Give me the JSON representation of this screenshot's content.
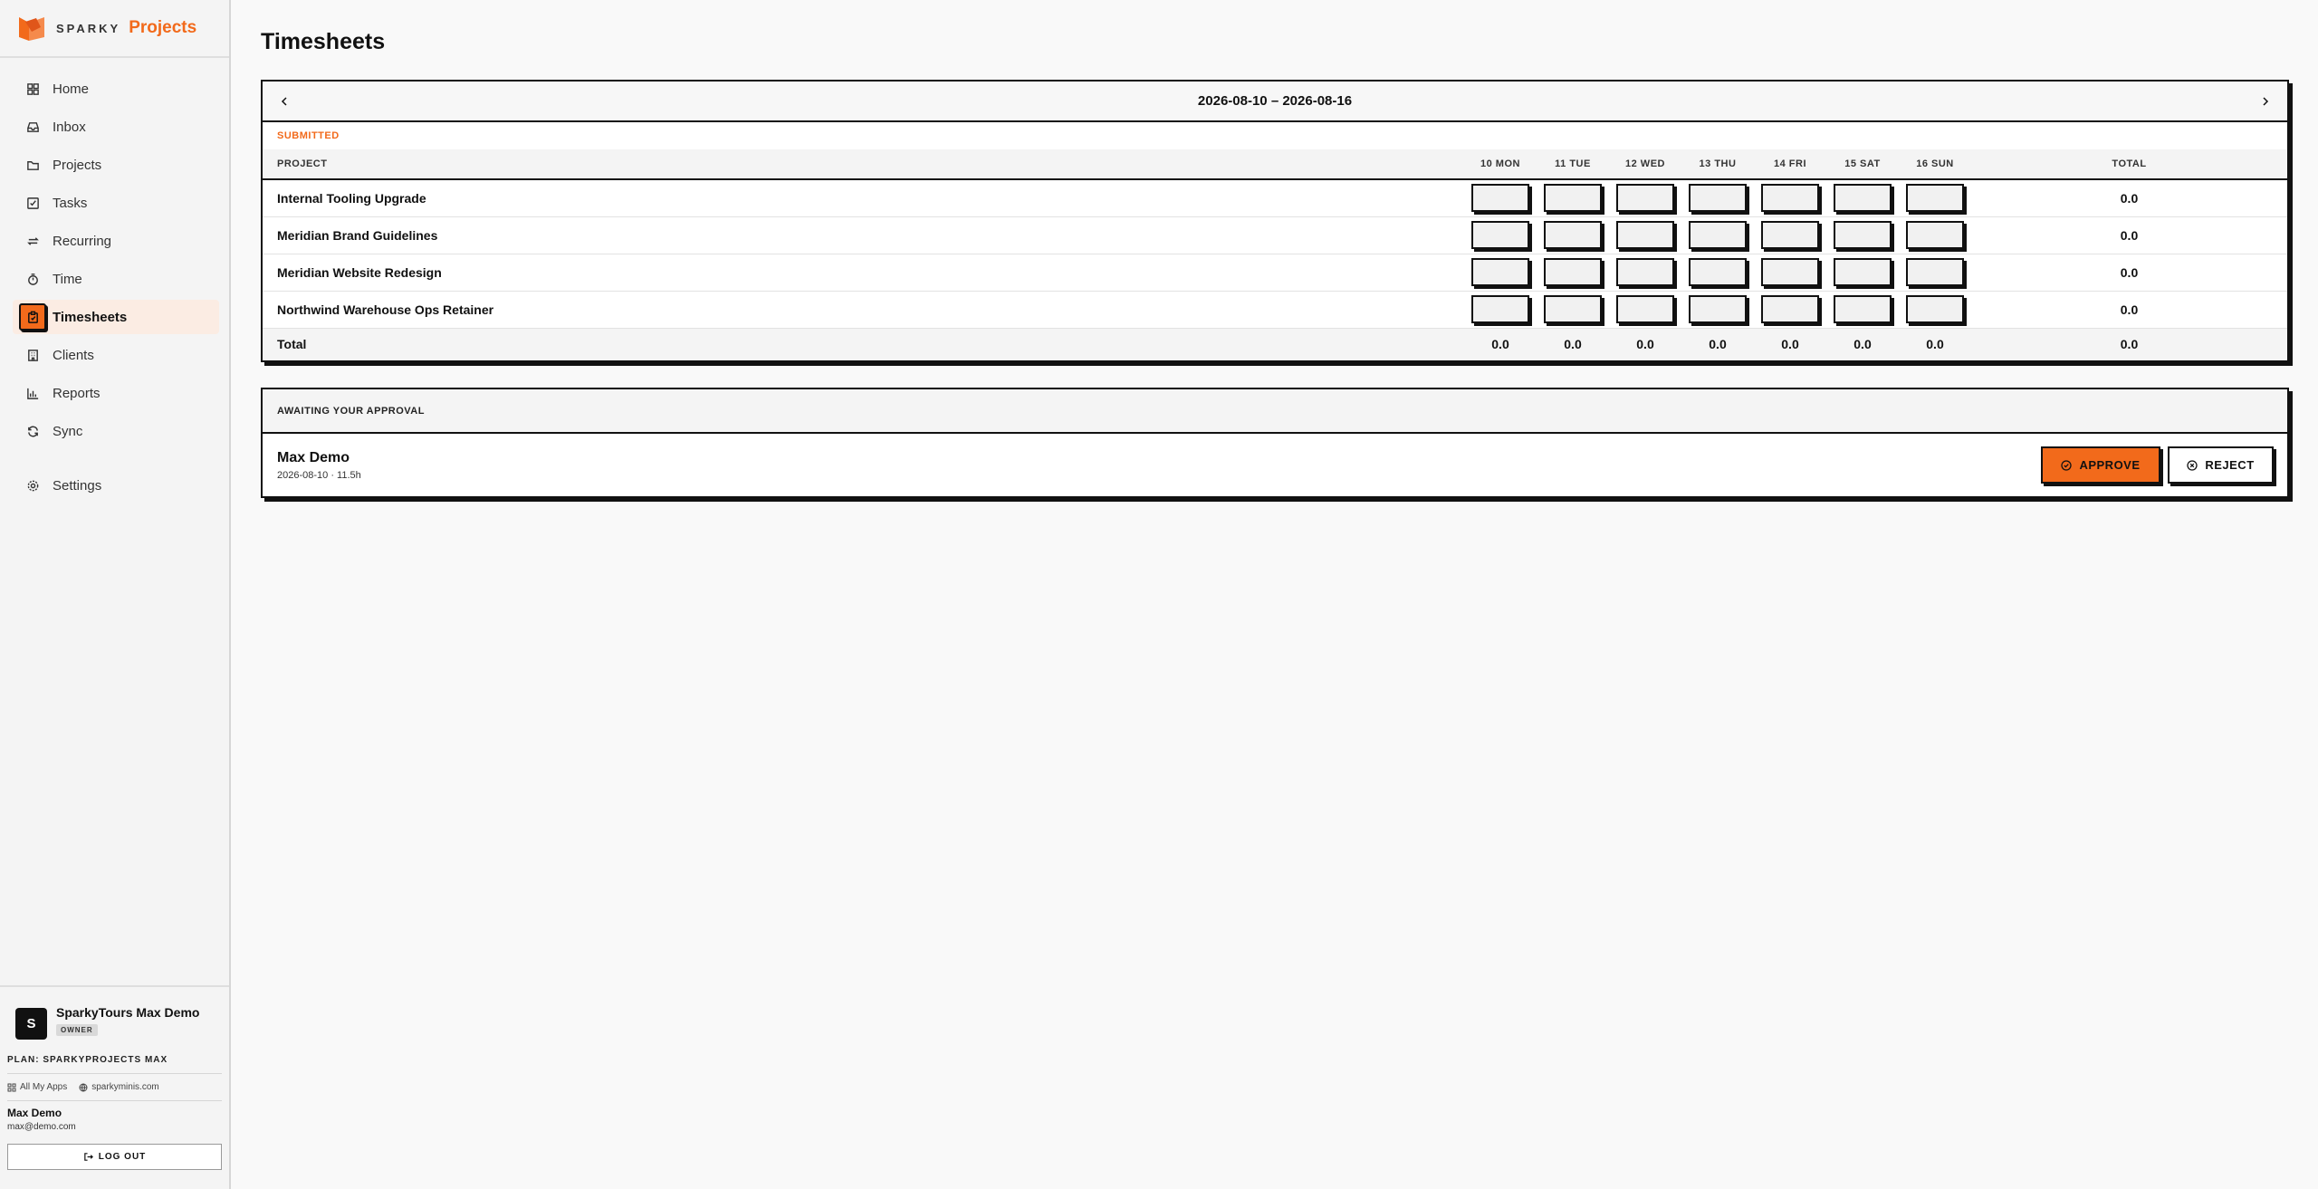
{
  "brand": {
    "name": "SPARKY",
    "product": "Projects"
  },
  "nav": {
    "items": [
      {
        "label": "Home",
        "icon": "home-icon"
      },
      {
        "label": "Inbox",
        "icon": "inbox-icon"
      },
      {
        "label": "Projects",
        "icon": "folder-icon"
      },
      {
        "label": "Tasks",
        "icon": "checkbox-icon"
      },
      {
        "label": "Recurring",
        "icon": "repeat-icon"
      },
      {
        "label": "Time",
        "icon": "timer-icon"
      },
      {
        "label": "Timesheets",
        "icon": "clipboard-icon",
        "active": true
      },
      {
        "label": "Clients",
        "icon": "building-icon"
      },
      {
        "label": "Reports",
        "icon": "bar-chart-icon"
      },
      {
        "label": "Sync",
        "icon": "sync-icon"
      }
    ],
    "settings": {
      "label": "Settings",
      "icon": "gear-icon"
    }
  },
  "footer": {
    "org_initial": "S",
    "org_name": "SparkyTours Max Demo",
    "role": "OWNER",
    "plan": "PLAN: SPARKYPROJECTS MAX",
    "links": {
      "apps": "All My Apps",
      "site": "sparkyminis.com"
    },
    "user_name": "Max Demo",
    "user_email": "max@demo.com",
    "logout": "LOG OUT"
  },
  "page": {
    "title": "Timesheets"
  },
  "timesheet": {
    "week": "2026-08-10 – 2026-08-16",
    "status": "SUBMITTED",
    "columns": {
      "project": "PROJECT",
      "days": [
        "10 MON",
        "11 TUE",
        "12 WED",
        "13 THU",
        "14 FRI",
        "15 SAT",
        "16 SUN"
      ],
      "total": "TOTAL"
    },
    "rows": [
      {
        "project": "Internal Tooling Upgrade",
        "total": "0.0"
      },
      {
        "project": "Meridian Brand Guidelines",
        "total": "0.0"
      },
      {
        "project": "Meridian Website Redesign",
        "total": "0.0"
      },
      {
        "project": "Northwind Warehouse Ops Retainer",
        "total": "0.0"
      }
    ],
    "totals": {
      "label": "Total",
      "days": [
        "0.0",
        "0.0",
        "0.0",
        "0.0",
        "0.0",
        "0.0",
        "0.0"
      ],
      "grand": "0.0"
    }
  },
  "approval": {
    "heading": "AWAITING YOUR APPROVAL",
    "entry": {
      "name": "Max Demo",
      "meta": "2026-08-10 · 11.5h"
    },
    "approve_label": "APPROVE",
    "reject_label": "REJECT"
  },
  "colors": {
    "accent": "#f26a1b",
    "ink": "#111111"
  }
}
